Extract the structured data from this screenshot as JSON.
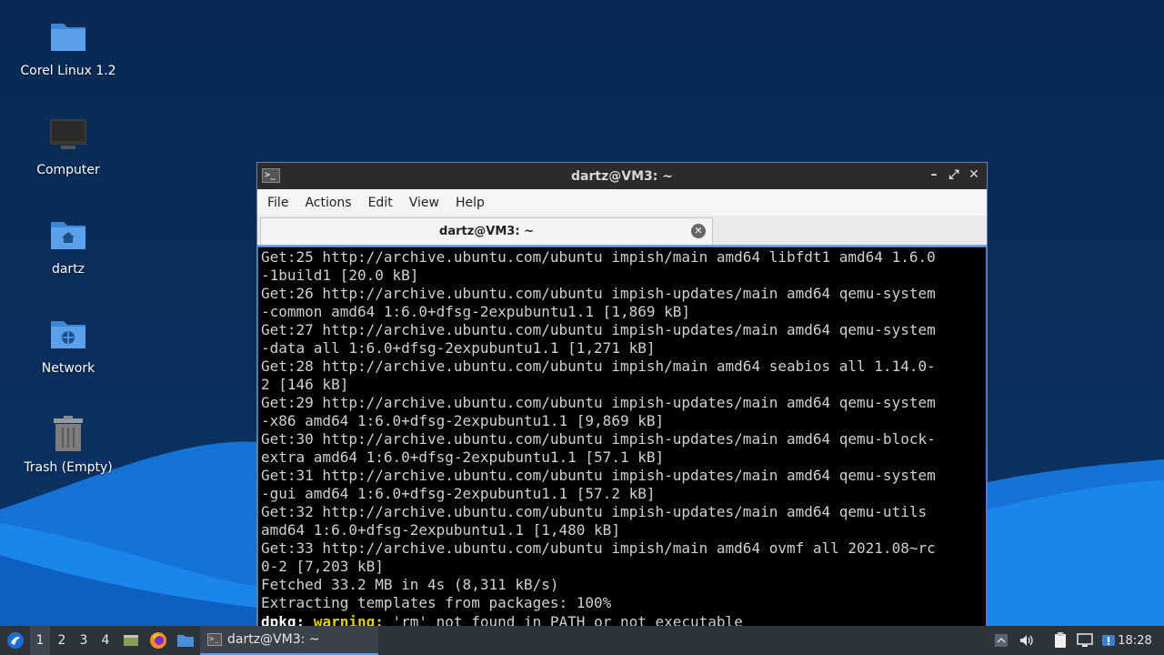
{
  "desktop": {
    "icons": [
      {
        "label": "Corel Linux 1.2",
        "icon": "folder-icon"
      },
      {
        "label": "Computer",
        "icon": "computer-icon"
      },
      {
        "label": "dartz",
        "icon": "home-folder-icon"
      },
      {
        "label": "Network",
        "icon": "network-folder-icon"
      },
      {
        "label": "Trash (Empty)",
        "icon": "trash-icon"
      }
    ]
  },
  "window": {
    "title": "dartz@VM3: ~",
    "menu": [
      "File",
      "Actions",
      "Edit",
      "View",
      "Help"
    ],
    "tab_label": "dartz@VM3: ~",
    "terminal_lines": [
      "Get:25 http://archive.ubuntu.com/ubuntu impish/main amd64 libfdt1 amd64 1.6.0",
      "-1build1 [20.0 kB]",
      "Get:26 http://archive.ubuntu.com/ubuntu impish-updates/main amd64 qemu-system",
      "-common amd64 1:6.0+dfsg-2expubuntu1.1 [1,869 kB]",
      "Get:27 http://archive.ubuntu.com/ubuntu impish-updates/main amd64 qemu-system",
      "-data all 1:6.0+dfsg-2expubuntu1.1 [1,271 kB]",
      "Get:28 http://archive.ubuntu.com/ubuntu impish/main amd64 seabios all 1.14.0-",
      "2 [146 kB]",
      "Get:29 http://archive.ubuntu.com/ubuntu impish-updates/main amd64 qemu-system",
      "-x86 amd64 1:6.0+dfsg-2expubuntu1.1 [9,869 kB]",
      "Get:30 http://archive.ubuntu.com/ubuntu impish-updates/main amd64 qemu-block-",
      "extra amd64 1:6.0+dfsg-2expubuntu1.1 [57.1 kB]",
      "Get:31 http://archive.ubuntu.com/ubuntu impish-updates/main amd64 qemu-system",
      "-gui amd64 1:6.0+dfsg-2expubuntu1.1 [57.2 kB]",
      "Get:32 http://archive.ubuntu.com/ubuntu impish-updates/main amd64 qemu-utils",
      "amd64 1:6.0+dfsg-2expubuntu1.1 [1,480 kB]",
      "Get:33 http://archive.ubuntu.com/ubuntu impish/main amd64 ovmf all 2021.08~rc",
      "0-2 [7,203 kB]",
      "Fetched 33.2 MB in 4s (8,311 kB/s)",
      "Extracting templates from packages: 100%"
    ],
    "last_line": {
      "prefix": "dpkg:",
      "keyword": "warning:",
      "rest": " 'rm' not found in PATH or not executable"
    }
  },
  "taskbar": {
    "workspaces": [
      "1",
      "2",
      "3",
      "4"
    ],
    "task_label": "dartz@VM3: ~",
    "clock": "18:28"
  }
}
